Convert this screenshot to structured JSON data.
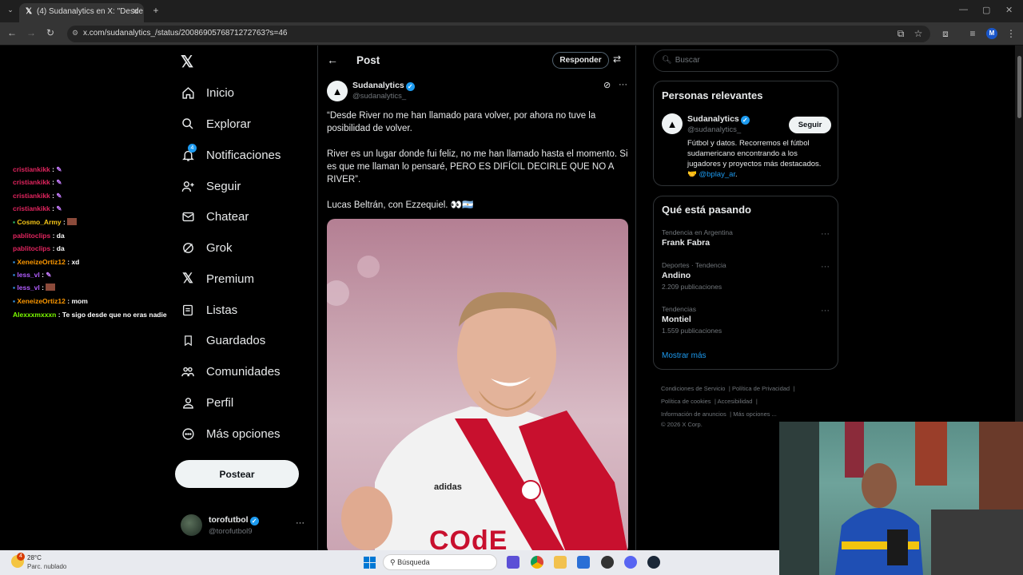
{
  "browser": {
    "tab_title": "(4) Sudanalytics en X: \"Desde R",
    "url": "x.com/sudanalytics_/status/2008690576871272763?s=46"
  },
  "nav": {
    "items": [
      {
        "label": "Inicio",
        "icon": "home-icon"
      },
      {
        "label": "Explorar",
        "icon": "search-icon"
      },
      {
        "label": "Notificaciones",
        "icon": "bell-icon",
        "badge": "4"
      },
      {
        "label": "Seguir",
        "icon": "person-plus-icon"
      },
      {
        "label": "Chatear",
        "icon": "mail-icon"
      },
      {
        "label": "Grok",
        "icon": "grok-icon"
      },
      {
        "label": "Premium",
        "icon": "x-icon"
      },
      {
        "label": "Listas",
        "icon": "list-icon"
      },
      {
        "label": "Guardados",
        "icon": "bookmark-icon"
      },
      {
        "label": "Comunidades",
        "icon": "people-icon"
      },
      {
        "label": "Perfil",
        "icon": "person-icon"
      },
      {
        "label": "Más opciones",
        "icon": "more-circle-icon"
      }
    ],
    "post_button": "Postear",
    "account": {
      "name": "torofutbol",
      "handle": "@torofutbol9"
    }
  },
  "post": {
    "header_title": "Post",
    "reply_button": "Responder",
    "author_name": "Sudanalytics",
    "author_handle": "@sudanalytics_",
    "paragraph1": "“Desde River no me han llamado para volver, por ahora no tuve la posibilidad de volver.",
    "paragraph2": "River es un lugar donde fui feliz, no me han llamado hasta el momento. Si es que me llaman lo pensaré, PERO ES DIFÍCIL DECIRLE QUE NO A RIVER”.",
    "paragraph3": "Lucas Beltrán, con Ezzequiel. 👀🇦🇷",
    "image_sponsor": "adidas",
    "image_shirt_text": "COdE"
  },
  "right": {
    "search_placeholder": "Buscar",
    "relevant_title": "Personas relevantes",
    "relevant": {
      "name": "Sudanalytics",
      "handle": "@sudanalytics_",
      "follow": "Seguir",
      "bio": "Fútbol y datos. Recorremos el fútbol sudamericano encontrando a los jugadores y proyectos más destacados. 🤝",
      "bio_link": "@bplay_ar"
    },
    "trending_title": "Qué está pasando",
    "trends": [
      {
        "category": "Tendencia en Argentina",
        "name": "Frank Fabra",
        "count": ""
      },
      {
        "category": "Deportes · Tendencia",
        "name": "Andino",
        "count": "2.209 publicaciones"
      },
      {
        "category": "Tendencias",
        "name": "Montiel",
        "count": "1.559 publicaciones"
      }
    ],
    "show_more": "Mostrar más",
    "footer": {
      "l1": "Condiciones de Servicio",
      "l2": "Política de Privacidad",
      "l3": "Política de cookies",
      "l4": "Accesibilidad",
      "l5": "Información de anuncios",
      "l6": "Más opciones ...",
      "copyright": "© 2026 X Corp."
    }
  },
  "chat": [
    {
      "user": "cristiankikk",
      "msg": "",
      "color": "#e0245e"
    },
    {
      "user": "cristiankikk",
      "msg": "",
      "color": "#e0245e"
    },
    {
      "user": "cristiankikk",
      "msg": "",
      "color": "#e0245e"
    },
    {
      "user": "cristiankikk",
      "msg": "",
      "color": "#e0245e"
    },
    {
      "user": "Cosmo_Army",
      "msg": "",
      "color": "#f5c518"
    },
    {
      "user": "pablitoclips",
      "msg": "da",
      "color": "#e0245e"
    },
    {
      "user": "pablitoclips",
      "msg": "da",
      "color": "#e0245e"
    },
    {
      "user": "XeneizeOrtiz12",
      "msg": "xd",
      "color": "#ff9900"
    },
    {
      "user": "less_vl",
      "msg": "",
      "color": "#b25cff"
    },
    {
      "user": "less_vl",
      "msg": "",
      "color": "#b25cff"
    },
    {
      "user": "XeneizeOrtiz12",
      "msg": "mom",
      "color": "#ff9900"
    },
    {
      "user": "Alexxxmxxxn",
      "msg": "Te sigo desde que no eras nadie",
      "color": "#7cfc00"
    }
  ],
  "taskbar": {
    "weather_temp": "28°C",
    "weather_desc": "Parc. nublado",
    "weather_badge": "4",
    "search_placeholder": "Búsqueda"
  }
}
